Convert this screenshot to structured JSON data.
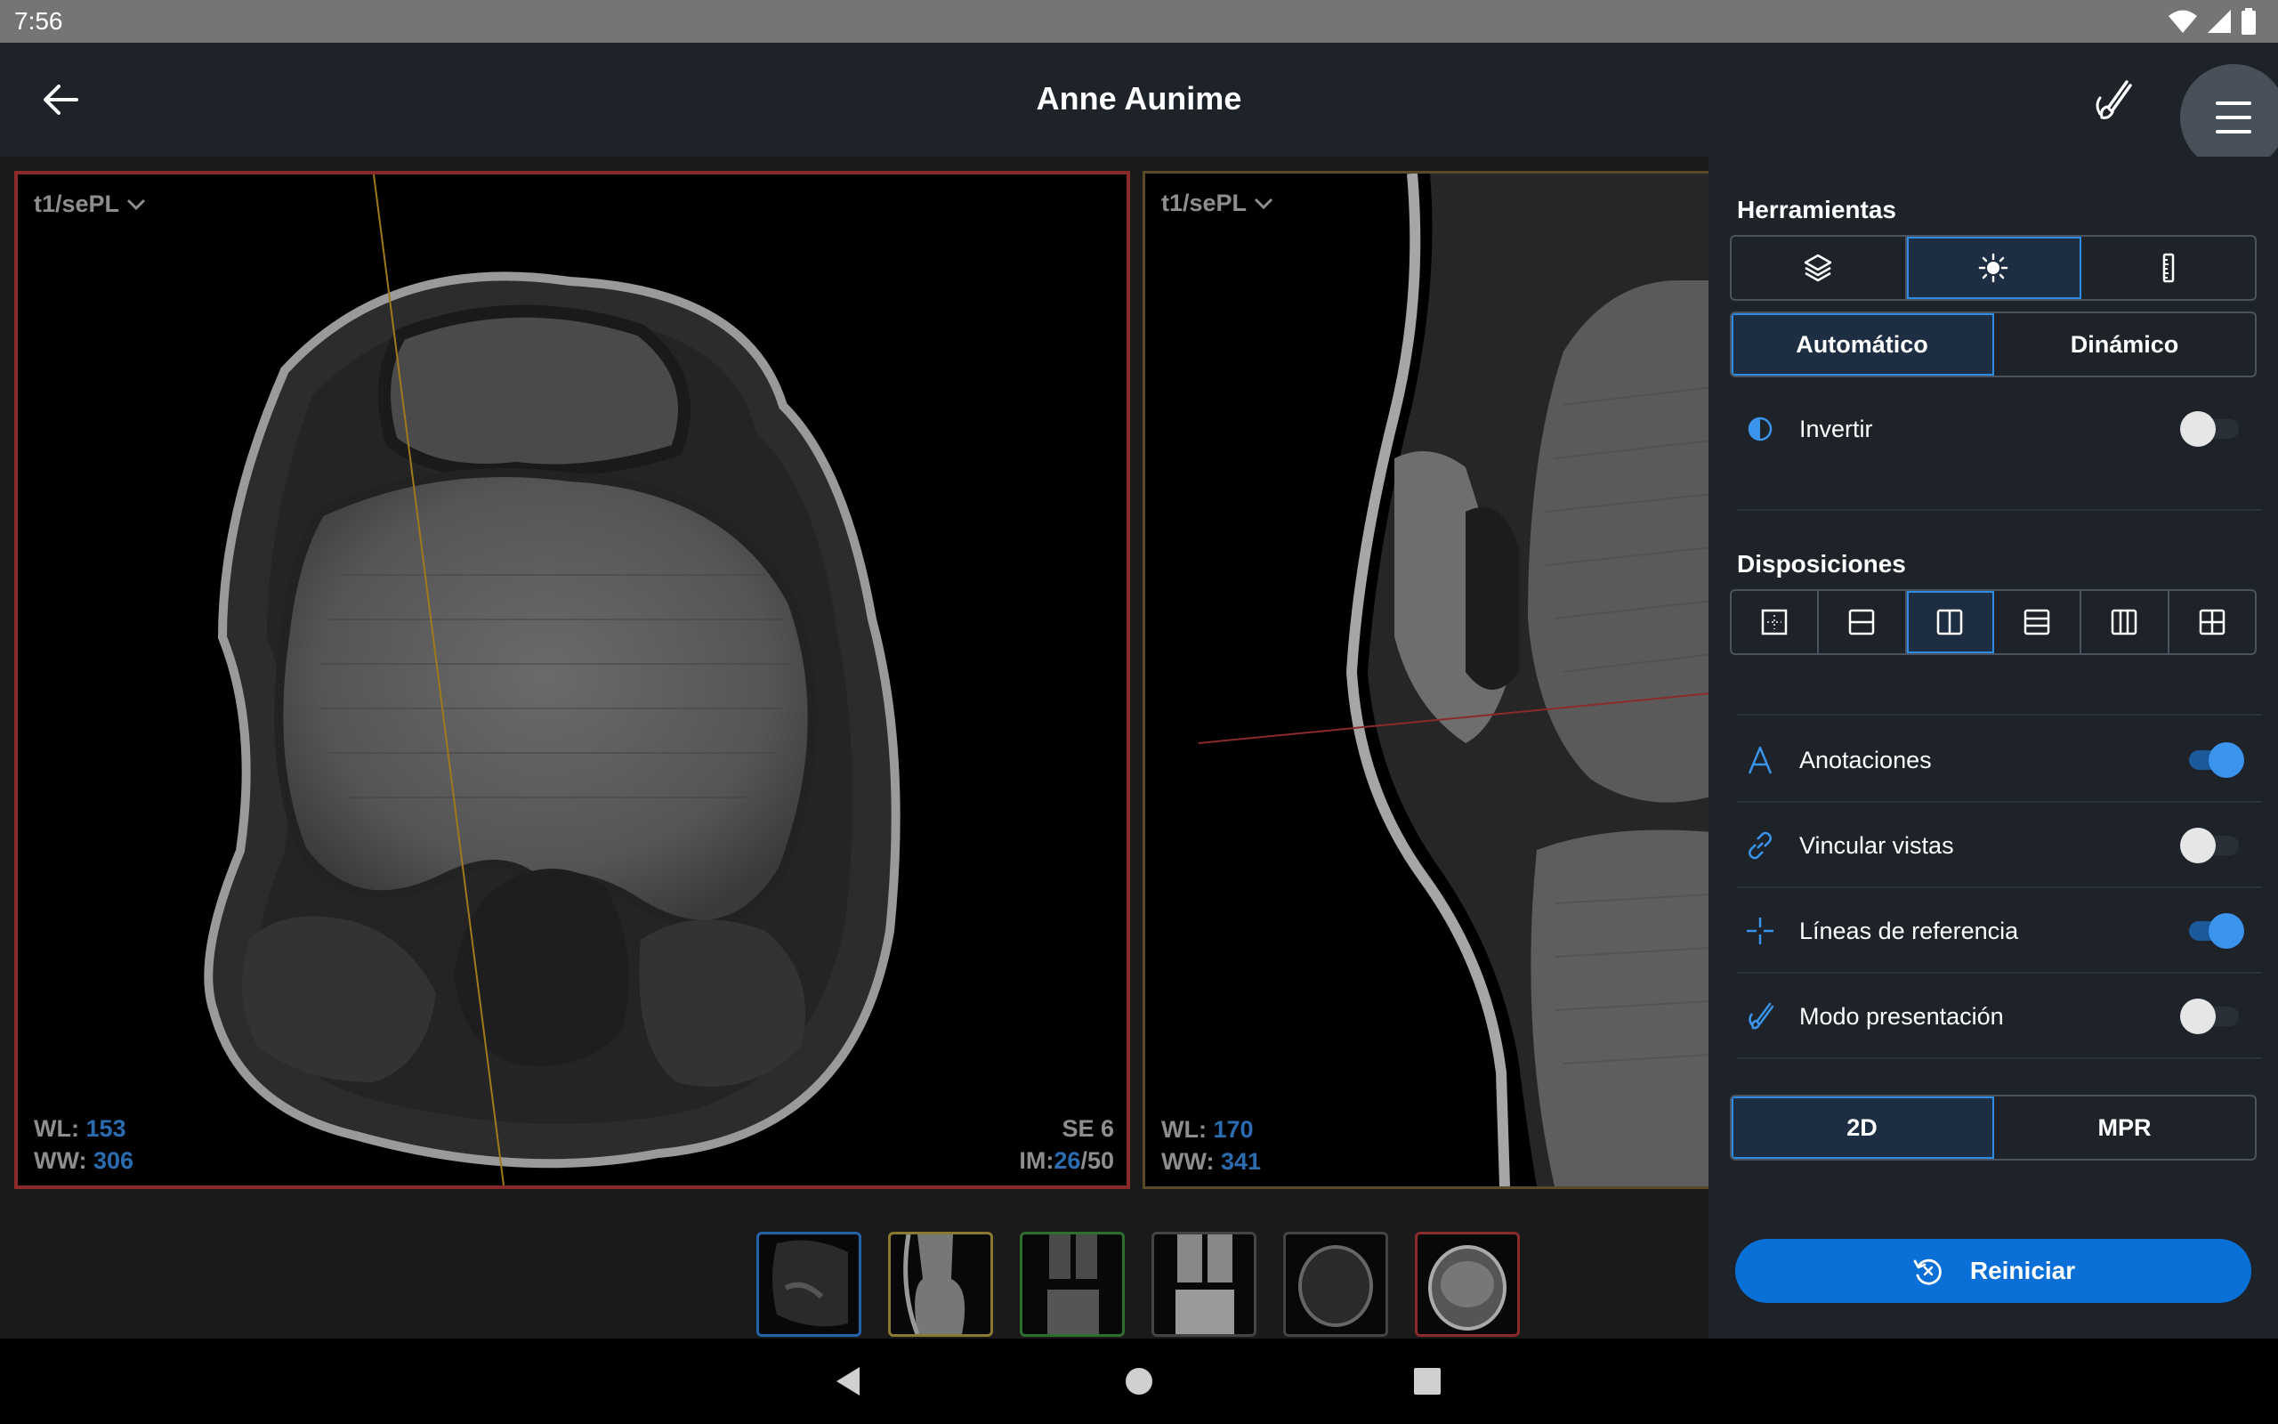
{
  "status_bar": {
    "time": "7:56"
  },
  "header": {
    "title": "Anne Aunime"
  },
  "viewports": [
    {
      "series": "t1/sePL",
      "wl_label": "WL:",
      "wl_value": "153",
      "ww_label": "WW:",
      "ww_value": "306",
      "se": "SE 6",
      "im_prefix": "IM:",
      "im_current": "26",
      "im_total": "/50"
    },
    {
      "series": "t1/sePL",
      "wl_label": "WL:",
      "wl_value": "170",
      "ww_label": "WW:",
      "ww_value": "341"
    }
  ],
  "panel": {
    "tools_title": "Herramientas",
    "tools": [
      "layers-icon",
      "brightness-icon",
      "ruler-icon"
    ],
    "mode_auto": "Automático",
    "mode_dynamic": "Dinámico",
    "invert_label": "Invertir",
    "invert_on": false,
    "layouts_title": "Disposiciones",
    "layouts": [
      "layout-single-icon",
      "layout-2-rows-icon",
      "layout-2-cols-icon",
      "layout-3-rows-icon",
      "layout-3-cols-icon",
      "layout-2x2-icon"
    ],
    "annotations_label": "Anotaciones",
    "annotations_on": true,
    "link_views_label": "Vincular vistas",
    "link_views_on": false,
    "reference_lines_label": "Líneas de referencia",
    "reference_lines_on": true,
    "presentation_label": "Modo presentación",
    "presentation_on": false,
    "view_2d": "2D",
    "view_mpr": "MPR",
    "reset_label": "Reiniciar"
  },
  "colors": {
    "accent": "#2d8ce8",
    "reset_button": "#0a6fd6",
    "panel_bg": "#1e2329",
    "active_viewport_border": "#8b2a2a"
  }
}
